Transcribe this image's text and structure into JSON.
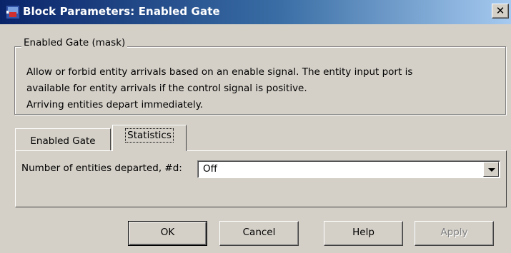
{
  "window": {
    "title": "Block Parameters: Enabled Gate",
    "close_label": "✕"
  },
  "description": {
    "legend": "Enabled Gate (mask)",
    "line1": "Allow or forbid entity arrivals based on an enable signal. The entity input port is",
    "line2": "available for entity arrivals if the control signal is positive.",
    "line3": "Arriving entities depart immediately."
  },
  "tabs": [
    {
      "label": "Enabled Gate",
      "selected": false
    },
    {
      "label": "Statistics",
      "selected": true
    }
  ],
  "statistics": {
    "field_label": "Number of entities departed, #d:",
    "field_value": "Off"
  },
  "buttons": {
    "ok": "OK",
    "cancel": "Cancel",
    "help": "Help",
    "apply": "Apply"
  },
  "colors": {
    "title_bar_start": "#0a246a",
    "title_bar_end": "#a6caf0",
    "dialog_bg": "#d4d0c8"
  }
}
